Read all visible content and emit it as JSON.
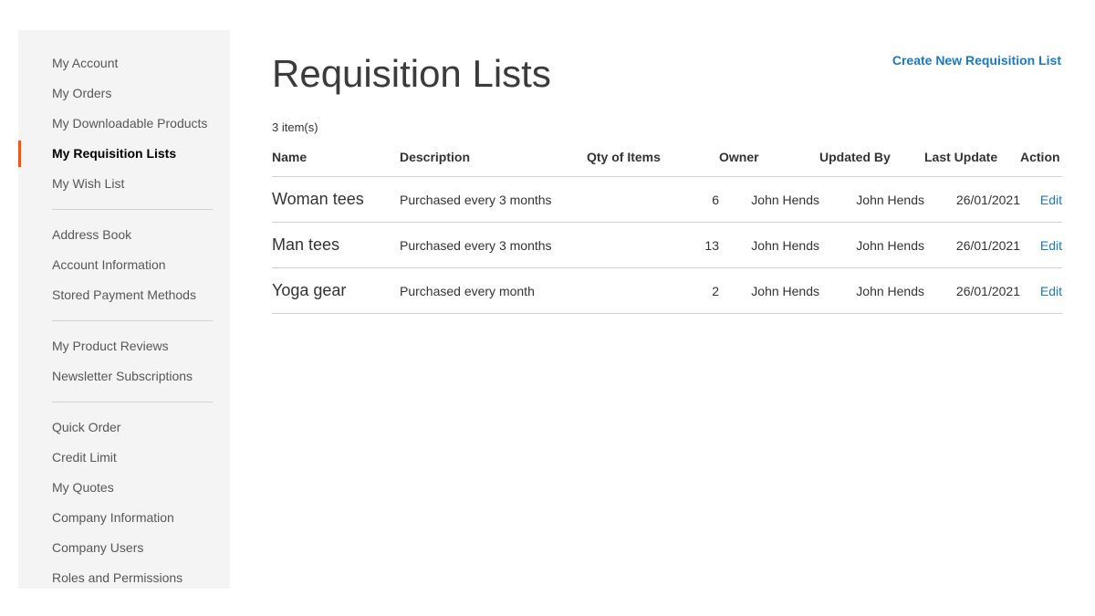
{
  "page": {
    "title": "Requisition Lists"
  },
  "header": {
    "create_link_label": "Create New Requisition List"
  },
  "sidebar": {
    "groups": [
      {
        "items": [
          {
            "label": "My Account",
            "current": false
          },
          {
            "label": "My Orders",
            "current": false
          },
          {
            "label": "My Downloadable Products",
            "current": false
          },
          {
            "label": "My Requisition Lists",
            "current": true
          },
          {
            "label": "My Wish List",
            "current": false
          }
        ]
      },
      {
        "items": [
          {
            "label": "Address Book",
            "current": false
          },
          {
            "label": "Account Information",
            "current": false
          },
          {
            "label": "Stored Payment Methods",
            "current": false
          }
        ]
      },
      {
        "items": [
          {
            "label": "My Product Reviews",
            "current": false
          },
          {
            "label": "Newsletter Subscriptions",
            "current": false
          }
        ]
      },
      {
        "items": [
          {
            "label": "Quick Order",
            "current": false
          },
          {
            "label": "Credit Limit",
            "current": false
          },
          {
            "label": "My Quotes",
            "current": false
          },
          {
            "label": "Company Information",
            "current": false
          },
          {
            "label": "Company Users",
            "current": false
          },
          {
            "label": "Roles and Permissions",
            "current": false
          }
        ]
      }
    ]
  },
  "toolbar": {
    "item_count_label": "3 item(s)"
  },
  "table": {
    "columns": [
      {
        "key": "name",
        "label": "Name"
      },
      {
        "key": "desc",
        "label": "Description"
      },
      {
        "key": "qty",
        "label": "Qty of Items"
      },
      {
        "key": "owner",
        "label": "Owner"
      },
      {
        "key": "updated",
        "label": "Updated By"
      },
      {
        "key": "date",
        "label": "Last Update"
      },
      {
        "key": "action",
        "label": "Action"
      }
    ],
    "rows": [
      {
        "name": "Woman tees",
        "desc": "Purchased every 3 months",
        "qty": "6",
        "owner": "John Hends",
        "updated": "John Hends",
        "date": "26/01/2021",
        "action": "Edit"
      },
      {
        "name": "Man tees",
        "desc": "Purchased every 3 months",
        "qty": "13",
        "owner": "John Hends",
        "updated": "John Hends",
        "date": "26/01/2021",
        "action": "Edit"
      },
      {
        "name": "Yoga gear",
        "desc": "Purchased every month",
        "qty": "2",
        "owner": "John Hends",
        "updated": "John Hends",
        "date": "26/01/2021",
        "action": "Edit"
      }
    ]
  },
  "colors": {
    "accent": "#ff5501",
    "link": "#1979c3",
    "sidebar_bg": "#f4f4f4",
    "border": "#d1d1d1"
  }
}
